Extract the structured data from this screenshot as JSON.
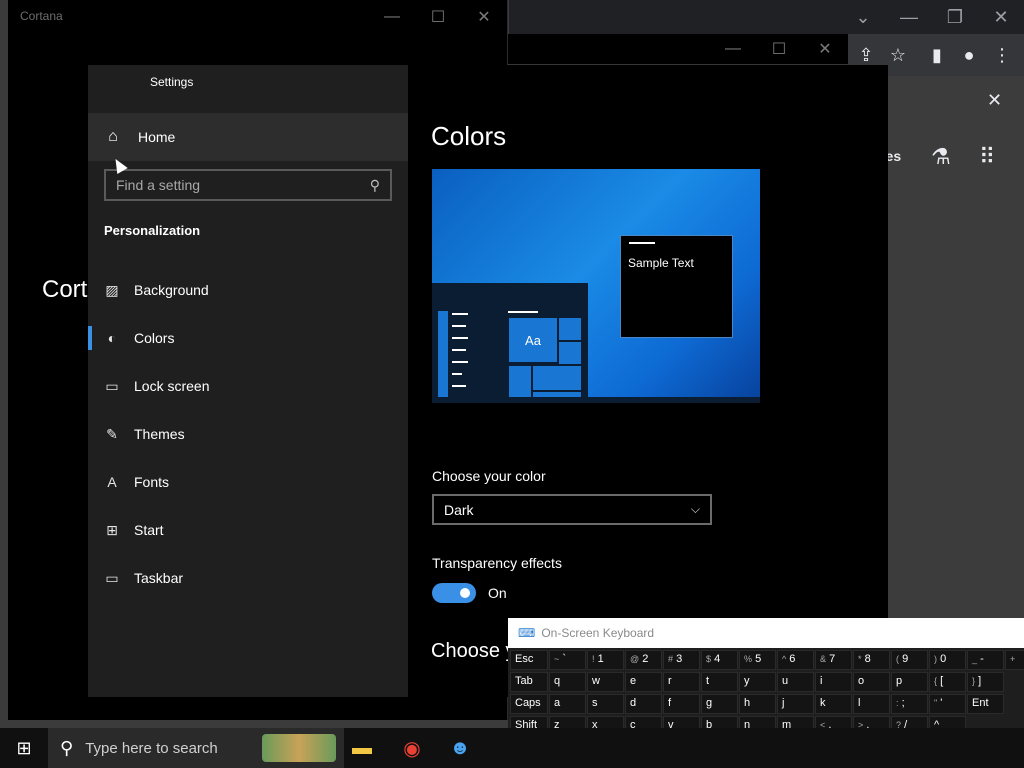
{
  "chrome": {
    "controls": [
      "⌄",
      "—",
      "❐",
      "✕"
    ],
    "inner_controls": [
      "—",
      "☐",
      "✕"
    ],
    "toolbar_icons": [
      "share-icon",
      "star-icon",
      "sidepanel-icon",
      "profile-icon",
      "menu-icon"
    ],
    "toolbar_glyphs": [
      "⇪",
      "☆",
      "▮",
      "●",
      "⋮"
    ],
    "panel_close": "✕",
    "partial_text": "ges",
    "labs_glyph": "⚗",
    "apps_glyph": "⠿"
  },
  "cortana": {
    "title": "Cortana",
    "controls": [
      "—",
      "☐",
      "✕"
    ],
    "partial_text": "Cort"
  },
  "settings": {
    "title": "Settings",
    "home_label": "Home",
    "home_glyph": "⌂",
    "search_placeholder": "Find a setting",
    "search_glyph": "⚲",
    "section": "Personalization",
    "nav": [
      {
        "label": "Background",
        "glyph": "▨",
        "icon": "picture-icon"
      },
      {
        "label": "Colors",
        "glyph": "◐",
        "icon": "palette-icon"
      },
      {
        "label": "Lock screen",
        "glyph": "▭",
        "icon": "lock-screen-icon"
      },
      {
        "label": "Themes",
        "glyph": "✎",
        "icon": "themes-icon"
      },
      {
        "label": "Fonts",
        "glyph": "A",
        "icon": "fonts-icon"
      },
      {
        "label": "Start",
        "glyph": "⊞",
        "icon": "start-icon"
      },
      {
        "label": "Taskbar",
        "glyph": "▭",
        "icon": "taskbar-icon"
      }
    ],
    "active_nav": "Colors",
    "accent_color": "#3a8fe6",
    "page_title": "Colors",
    "preview": {
      "sample_text": "Sample Text",
      "tile_text": "Aa"
    },
    "choose_color_label": "Choose your color",
    "choose_color_value": "Dark",
    "dropdown_glyph": "⌵",
    "transparency_label": "Transparency effects",
    "transparency_state": "On",
    "next_heading": "Choose y"
  },
  "osk": {
    "title": "On-Screen Keyboard",
    "kb_glyph": "⌨",
    "rows": [
      [
        [
          "",
          "Esc"
        ],
        [
          "~",
          "`"
        ],
        [
          "!",
          "1"
        ],
        [
          "@",
          "2"
        ],
        [
          "#",
          "3"
        ],
        [
          "$",
          "4"
        ],
        [
          "%",
          "5"
        ],
        [
          "^",
          "6"
        ],
        [
          "&",
          "7"
        ],
        [
          "*",
          "8"
        ],
        [
          "(",
          "9"
        ],
        [
          ")",
          "0"
        ],
        [
          "_",
          "-"
        ],
        [
          "+",
          ""
        ]
      ],
      [
        [
          "",
          "Tab"
        ],
        [
          "",
          "q"
        ],
        [
          "",
          "w"
        ],
        [
          "",
          "e"
        ],
        [
          "",
          "r"
        ],
        [
          "",
          "t"
        ],
        [
          "",
          "y"
        ],
        [
          "",
          "u"
        ],
        [
          "",
          "i"
        ],
        [
          "",
          "o"
        ],
        [
          "",
          "p"
        ],
        [
          "{",
          "["
        ],
        [
          "}",
          "]"
        ]
      ],
      [
        [
          "",
          "Caps"
        ],
        [
          "",
          "a"
        ],
        [
          "",
          "s"
        ],
        [
          "",
          "d"
        ],
        [
          "",
          "f"
        ],
        [
          "",
          "g"
        ],
        [
          "",
          "h"
        ],
        [
          "",
          "j"
        ],
        [
          "",
          "k"
        ],
        [
          "",
          "l"
        ],
        [
          ":",
          ";"
        ],
        [
          "\"",
          "'"
        ],
        [
          "",
          "Ent"
        ]
      ],
      [
        [
          "",
          "Shift"
        ],
        [
          "",
          "z"
        ],
        [
          "",
          "x"
        ],
        [
          "",
          "c"
        ],
        [
          "",
          "v"
        ],
        [
          "",
          "b"
        ],
        [
          "",
          "n"
        ],
        [
          "",
          "m"
        ],
        [
          "<",
          ","
        ],
        [
          ">",
          "."
        ],
        [
          "?",
          "/"
        ],
        [
          "",
          "^"
        ]
      ]
    ]
  },
  "taskbar": {
    "start_glyph": "⊞",
    "search_glyph": "⚲",
    "search_placeholder": "Type here to search",
    "apps": [
      {
        "icon": "file-explorer-icon",
        "glyph": "▬",
        "color": "#f2c744"
      },
      {
        "icon": "chrome-icon",
        "glyph": "◉",
        "color": "#e94235"
      },
      {
        "icon": "people-icon",
        "glyph": "☻",
        "color": "#4aa3f0"
      }
    ]
  }
}
